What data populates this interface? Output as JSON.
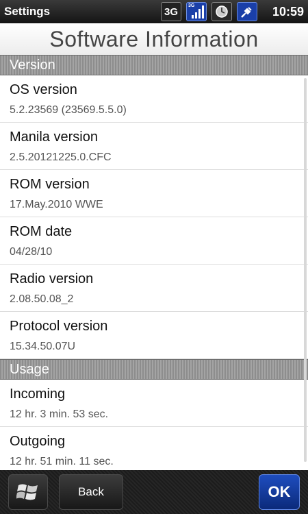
{
  "status_bar": {
    "title": "Settings",
    "network_label": "3G",
    "signal_badge": "3G",
    "time": "10:59",
    "icons": [
      "3g-icon",
      "signal-strength-icon",
      "sync-icon",
      "power-plug-icon"
    ]
  },
  "page": {
    "title": "Software Information"
  },
  "sections": {
    "version": {
      "header": "Version",
      "items": [
        {
          "label": "OS version",
          "value": "5.2.23569 (23569.5.5.0)"
        },
        {
          "label": "Manila version",
          "value": "2.5.20121225.0.CFC"
        },
        {
          "label": "ROM version",
          "value": "17.May.2010 WWE"
        },
        {
          "label": "ROM date",
          "value": "04/28/10"
        },
        {
          "label": "Radio version",
          "value": "2.08.50.08_2"
        },
        {
          "label": "Protocol version",
          "value": "15.34.50.07U"
        }
      ]
    },
    "usage": {
      "header": "Usage",
      "items": [
        {
          "label": "Incoming",
          "value": "12 hr. 3 min. 53 sec."
        },
        {
          "label": "Outgoing",
          "value": "12 hr. 51 min. 11 sec."
        }
      ]
    }
  },
  "bottom_bar": {
    "back_label": "Back",
    "ok_label": "OK",
    "start_icon": "windows-flag-icon"
  },
  "colors": {
    "ok_accent": "#1e4dbf",
    "section_header": "#999999"
  }
}
